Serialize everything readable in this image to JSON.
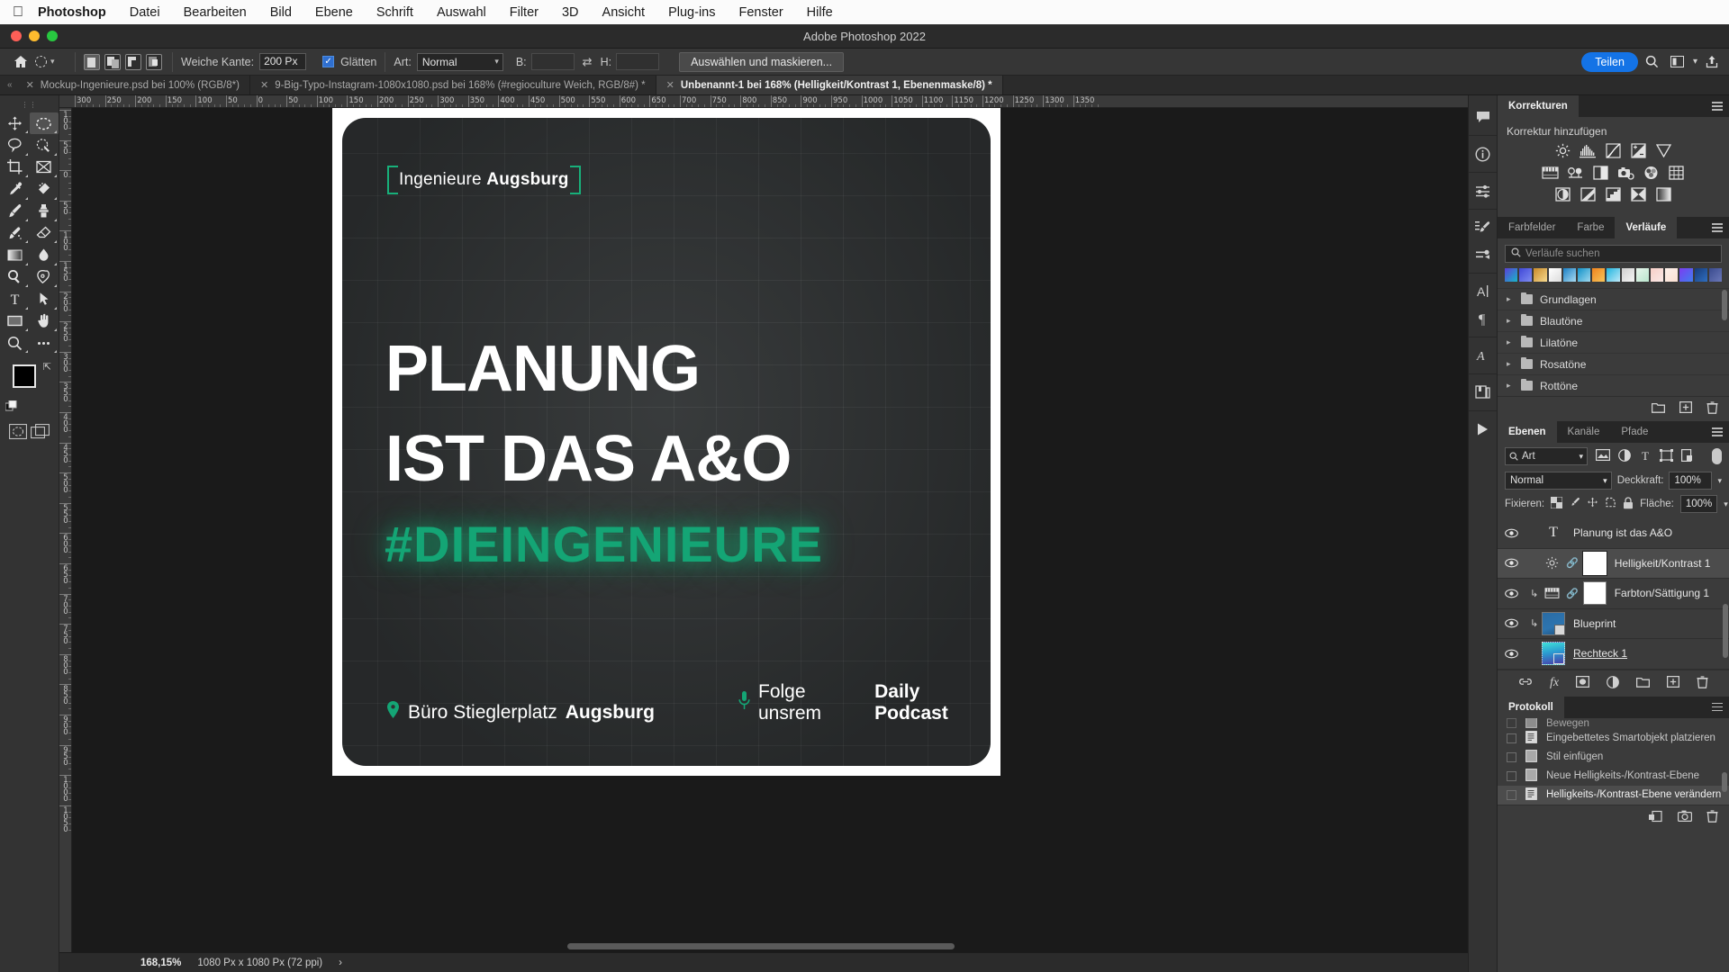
{
  "mac_menu": {
    "apple_icon": "apple-logo",
    "items": [
      "Photoshop",
      "Datei",
      "Bearbeiten",
      "Bild",
      "Ebene",
      "Schrift",
      "Auswahl",
      "Filter",
      "3D",
      "Ansicht",
      "Plug-ins",
      "Fenster",
      "Hilfe"
    ]
  },
  "titlebar": {
    "title": "Adobe Photoshop 2022"
  },
  "options_bar": {
    "home_icon": "home-icon",
    "tool_preset_icon": "elliptical-marquee-icon",
    "selection_modes": [
      "new-selection",
      "add-to-selection",
      "subtract-from-selection",
      "intersect-with-selection"
    ],
    "feather_label": "Weiche Kante:",
    "feather_value": "200 Px",
    "antialias_label": "Glätten",
    "antialias_checked": true,
    "style_label": "Art:",
    "style_value": "Normal",
    "width_label": "B:",
    "width_value": "",
    "swap_icon": "swap-arrows-icon",
    "height_label": "H:",
    "height_value": "",
    "select_mask_button": "Auswählen und maskieren...",
    "share_button": "Teilen",
    "search_icon": "search-icon",
    "workspace_icon": "workspace-icon",
    "chevron_icon": "chevron-down-icon",
    "export_icon": "share-export-icon"
  },
  "tabs": [
    {
      "label": "Mockup-Ingenieure.psd bei 100% (RGB/8*)",
      "active": false
    },
    {
      "label": "9-Big-Typo-Instagram-1080x1080.psd bei 168% (#regioculture Weich, RGB/8#) *",
      "active": false
    },
    {
      "label": "Unbenannt-1 bei 168% (Helligkeit/Kontrast 1, Ebenenmaske/8) *",
      "active": true
    }
  ],
  "tools": [
    "move-tool",
    "elliptical-marquee-tool",
    "lasso-tool",
    "quick-selection-tool",
    "crop-tool",
    "frame-tool",
    "eyedropper-tool",
    "spot-healing-brush-tool",
    "brush-tool",
    "clone-stamp-tool",
    "history-brush-tool",
    "eraser-tool",
    "gradient-tool",
    "blur-tool",
    "dodge-tool",
    "pen-tool",
    "type-tool",
    "path-selection-tool",
    "rectangle-tool",
    "hand-tool",
    "zoom-tool",
    "edit-toolbar-tool"
  ],
  "tool_active": "elliptical-marquee-tool",
  "color_swatches": {
    "foreground": "#000000",
    "background": "#ffffff"
  },
  "rulers": {
    "top_ticks": [
      "300",
      "250",
      "200",
      "150",
      "100",
      "50",
      "0",
      "50",
      "100",
      "150",
      "200",
      "250",
      "300",
      "350",
      "400",
      "450",
      "500",
      "550",
      "600",
      "650",
      "700",
      "750",
      "800",
      "850",
      "900",
      "950",
      "1000",
      "1050",
      "1100",
      "1150",
      "1200",
      "1250",
      "1300",
      "1350"
    ],
    "left_ticks": [
      "100",
      "50",
      "0",
      "50",
      "100",
      "150",
      "200",
      "250",
      "300",
      "350",
      "400",
      "450",
      "500",
      "550",
      "600",
      "650",
      "700",
      "750",
      "800",
      "850",
      "900",
      "950",
      "1000",
      "1050"
    ]
  },
  "artwork": {
    "badge_text_light": "Ingenieure ",
    "badge_text_bold": "Augsburg",
    "headline_line1": "PLANUNG",
    "headline_line2": "IST DAS A&O",
    "hashtag": "#DIEINGENIEURE",
    "footer_left_icon": "location-pin-icon",
    "footer_left_light": "Büro Stieglerplatz ",
    "footer_left_bold": "Augsburg",
    "footer_right_icon": "microphone-icon",
    "footer_right_light": "Folge unsrem ",
    "footer_right_bold": "Daily Podcast",
    "accent_color": "#14a575",
    "background_color": "#2e3132"
  },
  "statusbar": {
    "zoom": "168,15%",
    "doc_size": "1080 Px x 1080 Px (72 ppi)",
    "chevron": "›"
  },
  "rail_icons": [
    "comment-icon",
    "info-icon",
    "adjustments-icon",
    "brush-settings-icon",
    "brush-presets-icon",
    "character-icon",
    "paragraph-icon",
    "glyphs-icon",
    "libraries-icon",
    "play-icon"
  ],
  "panels": {
    "korrekturen": {
      "tab_label": "Korrekturen",
      "menu_icon": "panel-menu-icon",
      "add_label": "Korrektur hinzufügen",
      "row1": [
        "brightness-contrast-icon",
        "levels-icon",
        "curves-icon",
        "exposure-icon",
        "vibrance-icon"
      ],
      "row2": [
        "hue-saturation-icon",
        "color-balance-icon",
        "black-white-icon",
        "photo-filter-icon",
        "channel-mixer-icon",
        "color-lookup-icon"
      ],
      "row3": [
        "invert-icon",
        "posterize-icon",
        "threshold-icon",
        "selective-color-icon",
        "gradient-map-icon"
      ]
    },
    "verlaeufe": {
      "tabs": [
        "Farbfelder",
        "Farbe",
        "Verläufe"
      ],
      "active_tab": "Verläufe",
      "menu_icon": "panel-menu-icon",
      "search_icon": "search-icon",
      "search_placeholder": "Verläufe suchen",
      "gradient_swatches": [
        [
          "#5a3fd6",
          "#19b6c8"
        ],
        [
          "#4048d8",
          "#7e8cf0"
        ],
        [
          "#c98a2a",
          "#f6d98e"
        ],
        [
          "#ffffff",
          "#dcdcdc"
        ],
        [
          "#1b7fc4",
          "#a9dbf2"
        ],
        [
          "#1192c9",
          "#9fd8ee"
        ],
        [
          "#f0831e",
          "#f7c55a"
        ],
        [
          "#1fb5e0",
          "#bfe9f7"
        ],
        [
          "#cfcfcf",
          "#f5f5f5"
        ],
        [
          "#e8f5ec",
          "#b9e6cd"
        ],
        [
          "#f7cfc8",
          "#fae9e6"
        ],
        [
          "#fdf0ea",
          "#fbe0d2"
        ],
        [
          "#7b3df0",
          "#3f7ef0"
        ],
        [
          "#173b7a",
          "#2f6fc0"
        ],
        [
          "#3a4b8f",
          "#6b78b8"
        ]
      ],
      "folders": [
        "Grundlagen",
        "Blautöne",
        "Lilatöne",
        "Rosatöne",
        "Rottöne"
      ],
      "footer_icons": [
        "new-folder-icon",
        "new-gradient-icon",
        "delete-icon"
      ]
    },
    "ebenen": {
      "tabs": [
        "Ebenen",
        "Kanäle",
        "Pfade"
      ],
      "active_tab": "Ebenen",
      "menu_icon": "panel-menu-icon",
      "filter_label": "Art",
      "filter_search_icon": "search-icon",
      "filter_icons": [
        "pixel-layers-icon",
        "adjustment-layers-icon",
        "type-layers-icon",
        "shape-layers-icon",
        "smart-object-layers-icon"
      ],
      "filter_toggle": "filter-toggle",
      "blend_mode": "Normal",
      "opacity_label": "Deckkraft:",
      "opacity_value": "100%",
      "lock_label": "Fixieren:",
      "lock_icons": [
        "lock-transparent-pixels-icon",
        "lock-image-pixels-icon",
        "lock-position-icon",
        "lock-artboard-icon",
        "lock-all-icon"
      ],
      "fill_label": "Fläche:",
      "fill_value": "100%",
      "layers": [
        {
          "name": "Planung ist das A&O",
          "type": "text",
          "visible": true,
          "selected": false,
          "clipped": false,
          "linked": false,
          "underline": false
        },
        {
          "name": "Helligkeit/Kontrast 1",
          "type": "brightness-contrast",
          "visible": true,
          "selected": true,
          "clipped": false,
          "linked": true,
          "underline": false
        },
        {
          "name": "Farbton/Sättigung 1",
          "type": "hue-saturation",
          "visible": true,
          "selected": false,
          "clipped": true,
          "linked": true,
          "underline": false
        },
        {
          "name": "Blueprint",
          "type": "smart-object",
          "visible": true,
          "selected": false,
          "clipped": true,
          "linked": false,
          "underline": false
        },
        {
          "name": "Rechteck 1",
          "type": "shape",
          "visible": true,
          "selected": false,
          "clipped": false,
          "linked": false,
          "underline": true
        }
      ],
      "footer_icons": [
        "link-layers-icon",
        "layer-style-fx-icon",
        "layer-mask-icon",
        "new-adjustment-layer-icon",
        "new-group-icon",
        "new-layer-icon",
        "delete-layer-icon"
      ]
    },
    "protokoll": {
      "tab_label": "Protokoll",
      "menu_icon": "panel-menu-icon",
      "entries": [
        {
          "label": "Bewegen",
          "selected": false,
          "partial": true
        },
        {
          "label": "Eingebettetes Smartobjekt platzieren",
          "selected": false,
          "partial": false
        },
        {
          "label": "Stil einfügen",
          "selected": false,
          "partial": false
        },
        {
          "label": "Neue Helligkeits-/Kontrast-Ebene",
          "selected": false,
          "partial": false
        },
        {
          "label": "Helligkeits-/Kontrast-Ebene verändern",
          "selected": true,
          "partial": false
        }
      ],
      "footer_icons": [
        "new-document-from-state-icon",
        "snapshot-camera-icon",
        "delete-icon"
      ]
    }
  }
}
